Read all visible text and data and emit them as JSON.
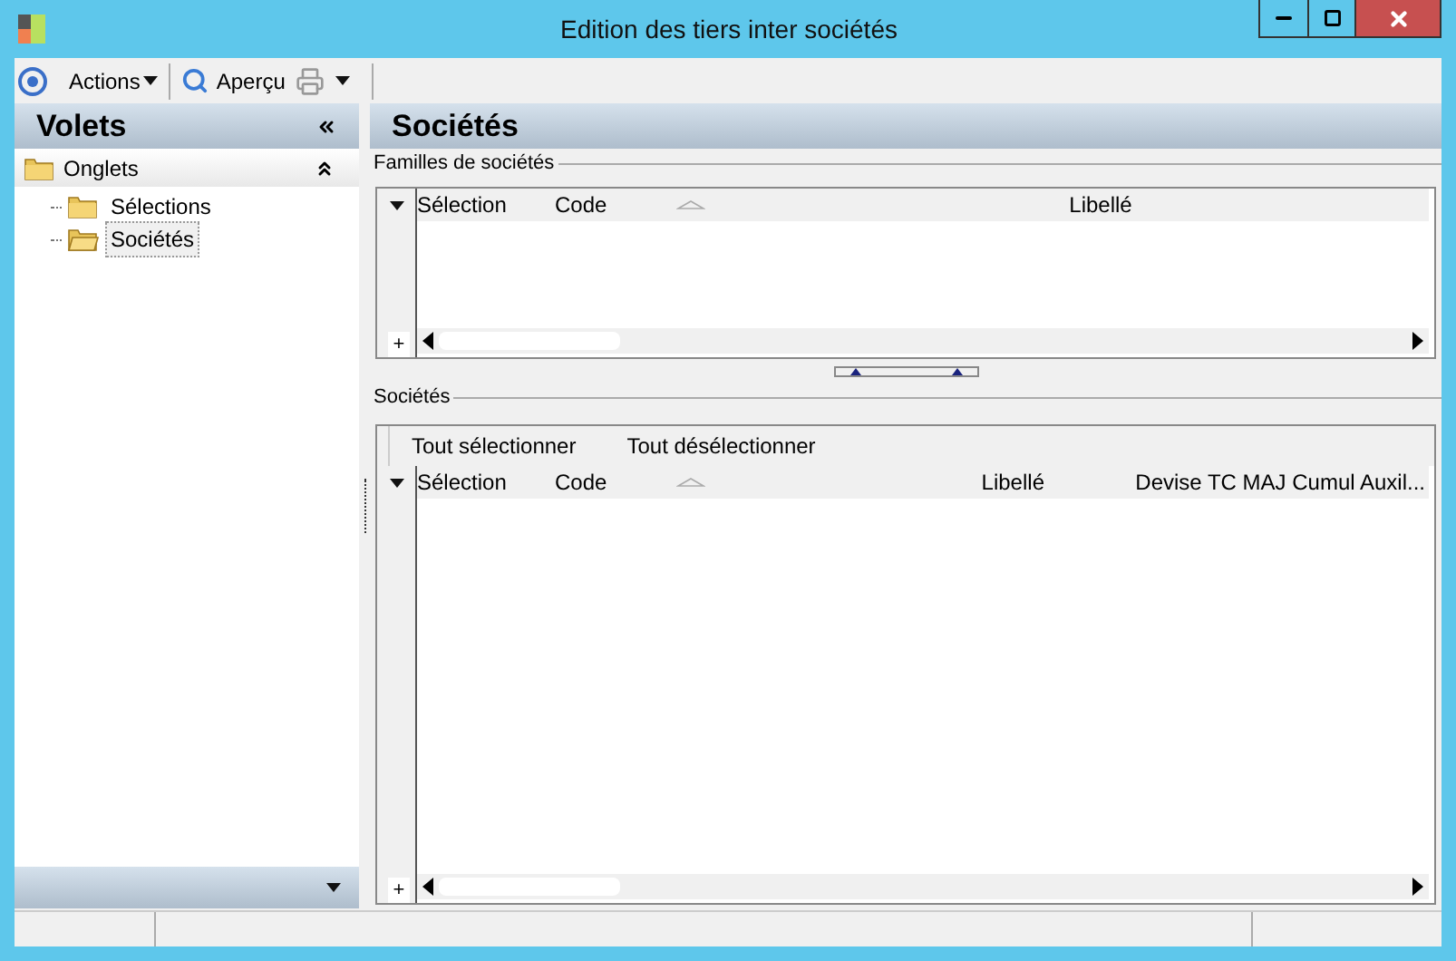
{
  "window": {
    "title": "Edition des tiers inter sociétés"
  },
  "toolbar": {
    "actions": "Actions",
    "preview": "Aperçu"
  },
  "sidebar": {
    "title": "Volets",
    "section": "Onglets",
    "items": [
      {
        "label": "Sélections",
        "selected": false
      },
      {
        "label": "Sociétés",
        "selected": true
      }
    ]
  },
  "main": {
    "title": "Sociétés",
    "families": {
      "label": "Familles de sociétés",
      "columns": [
        "Sélection",
        "Code",
        "Libellé"
      ],
      "add": "+"
    },
    "companies": {
      "label": "Sociétés",
      "buttons": [
        "Tout sélectionner",
        "Tout désélectionner"
      ],
      "columns": [
        "Sélection",
        "Code",
        "Libellé",
        "Devise TC MAJ Cumul Auxil..."
      ],
      "add": "+"
    }
  }
}
